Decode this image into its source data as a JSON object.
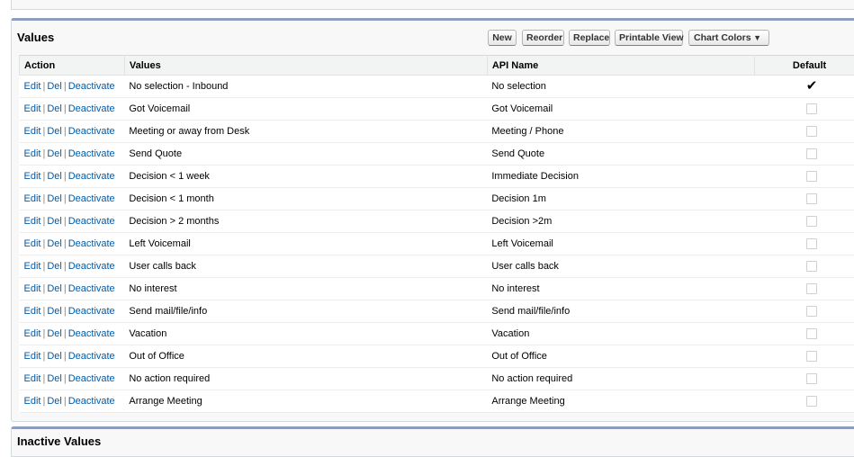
{
  "panel": {
    "title": "Values",
    "buttons": {
      "new": "New",
      "reorder": "Reorder",
      "replace": "Replace",
      "printable": "Printable View",
      "chart_colors": "Chart Colors"
    }
  },
  "table": {
    "headers": {
      "action": "Action",
      "values": "Values",
      "api_name": "API Name",
      "default": "Default"
    },
    "action_links": {
      "edit": "Edit",
      "del": "Del",
      "deactivate": "Deactivate"
    },
    "rows": [
      {
        "value": "No selection - Inbound",
        "api": "No selection",
        "default": true
      },
      {
        "value": "Got Voicemail",
        "api": "Got Voicemail",
        "default": false
      },
      {
        "value": "Meeting or away from Desk",
        "api": "Meeting / Phone",
        "default": false
      },
      {
        "value": "Send Quote",
        "api": "Send Quote",
        "default": false
      },
      {
        "value": "Decision < 1 week",
        "api": "Immediate Decision",
        "default": false
      },
      {
        "value": "Decision < 1 month",
        "api": "Decision 1m",
        "default": false
      },
      {
        "value": "Decision > 2 months",
        "api": "Decision >2m",
        "default": false
      },
      {
        "value": "Left Voicemail",
        "api": "Left Voicemail",
        "default": false
      },
      {
        "value": "User calls back",
        "api": "User calls back",
        "default": false
      },
      {
        "value": "No interest",
        "api": "No interest",
        "default": false
      },
      {
        "value": "Send mail/file/info",
        "api": "Send mail/file/info",
        "default": false
      },
      {
        "value": "Vacation",
        "api": "Vacation",
        "default": false
      },
      {
        "value": "Out of Office",
        "api": "Out of Office",
        "default": false
      },
      {
        "value": "No action required",
        "api": "No action required",
        "default": false
      },
      {
        "value": "Arrange Meeting",
        "api": "Arrange Meeting",
        "default": false
      }
    ]
  },
  "bottom_panel": {
    "title": "Inactive Values"
  },
  "colors": {
    "link": "#015ba7",
    "panel_border": "#8e9dbe"
  }
}
